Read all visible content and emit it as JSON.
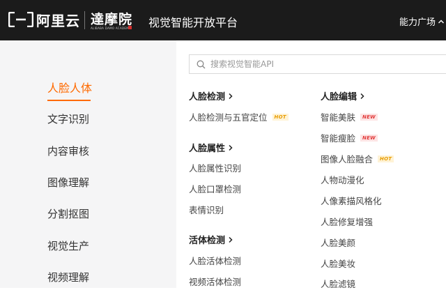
{
  "header": {
    "logo_text": "阿里云",
    "academy_name": "達摩院",
    "academy_sub": "ALIBABA DAMO ACADEMY",
    "platform_title": "视觉智能开放平台",
    "top_nav_label": "能力广场"
  },
  "sidebar": {
    "items": [
      {
        "label": "人脸人体"
      },
      {
        "label": "文字识别"
      },
      {
        "label": "内容审核"
      },
      {
        "label": "图像理解"
      },
      {
        "label": "分割抠图"
      },
      {
        "label": "视觉生产"
      },
      {
        "label": "视频理解"
      }
    ],
    "active_index": 0
  },
  "search": {
    "placeholder": "搜索视觉智能API",
    "value": ""
  },
  "columns": {
    "left": {
      "groups": [
        {
          "title": "人脸检测",
          "items": [
            {
              "label": "人脸检测与五官定位",
              "badge": "HOT"
            }
          ]
        },
        {
          "title": "人脸属性",
          "items": [
            {
              "label": "人脸属性识别"
            },
            {
              "label": "人脸口罩检测"
            },
            {
              "label": "表情识别"
            }
          ]
        },
        {
          "title": "活体检测",
          "items": [
            {
              "label": "人脸活体检测"
            },
            {
              "label": "视频活体检测"
            }
          ]
        }
      ]
    },
    "right": {
      "groups": [
        {
          "title": "人脸编辑",
          "items": [
            {
              "label": "智能美肤",
              "badge": "NEW"
            },
            {
              "label": "智能瘦脸",
              "badge": "NEW"
            },
            {
              "label": "图像人脸融合",
              "badge": "HOT"
            },
            {
              "label": "人物动漫化"
            },
            {
              "label": "人像素描风格化"
            },
            {
              "label": "人脸修复增强"
            },
            {
              "label": "人脸美颜"
            },
            {
              "label": "人脸美妆"
            },
            {
              "label": "人脸滤镜"
            }
          ]
        }
      ]
    }
  },
  "colors": {
    "header_bg": "#1b1b1b",
    "accent": "#ff6a00",
    "sidebar_bg": "#f5f5f6",
    "hot_badge": "#e89c00",
    "new_badge": "#e23b3b"
  }
}
